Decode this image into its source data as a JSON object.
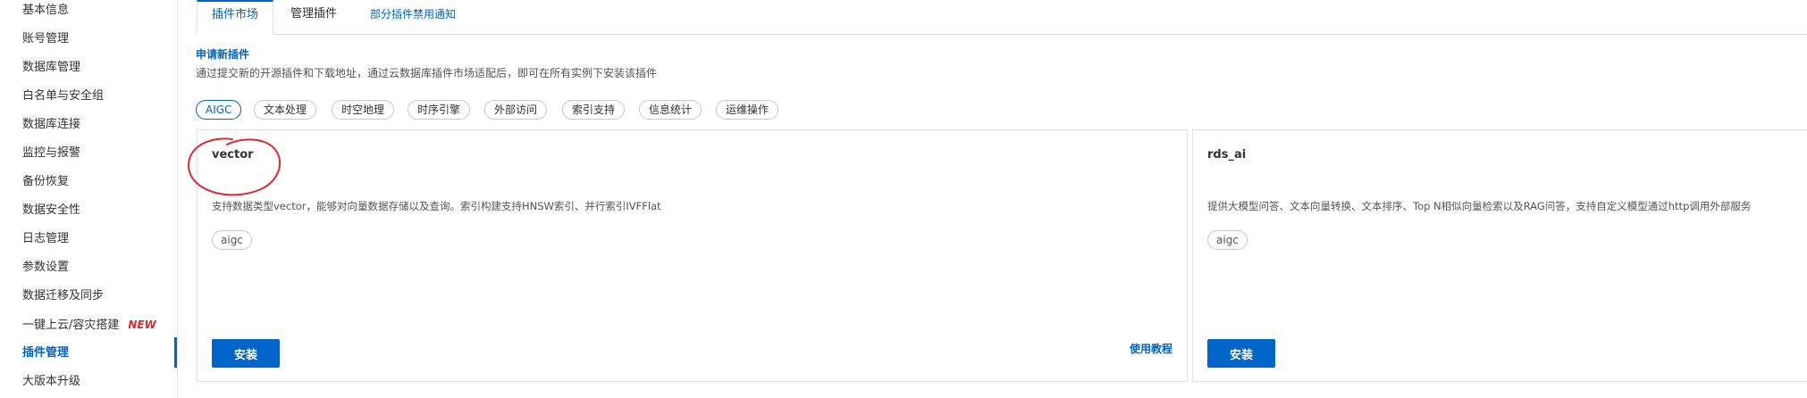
{
  "sidebar": {
    "items": [
      {
        "label": "基本信息"
      },
      {
        "label": "账号管理"
      },
      {
        "label": "数据库管理"
      },
      {
        "label": "白名单与安全组"
      },
      {
        "label": "数据库连接"
      },
      {
        "label": "监控与报警"
      },
      {
        "label": "备份恢复"
      },
      {
        "label": "数据安全性"
      },
      {
        "label": "日志管理"
      },
      {
        "label": "参数设置"
      },
      {
        "label": "数据迁移及同步"
      },
      {
        "label": "一键上云/容灾搭建",
        "badge": "NEW"
      },
      {
        "label": "插件管理",
        "active": true
      },
      {
        "label": "大版本升级"
      }
    ]
  },
  "tabs": [
    {
      "label": "插件市场",
      "active": true
    },
    {
      "label": "管理插件"
    },
    {
      "label": "部分插件禁用通知"
    }
  ],
  "apply": {
    "title": "申请新插件",
    "description": "通过提交新的开源插件和下载地址，通过云数据库插件市场适配后，即可在所有实例下安装该插件"
  },
  "filters": [
    {
      "label": "AIGC",
      "active": true
    },
    {
      "label": "文本处理"
    },
    {
      "label": "时空地理"
    },
    {
      "label": "时序引擎"
    },
    {
      "label": "外部访问"
    },
    {
      "label": "索引支持"
    },
    {
      "label": "信息统计"
    },
    {
      "label": "运维操作"
    }
  ],
  "cards": [
    {
      "title": "vector",
      "description": "支持数据类型vector，能够对向量数据存储以及查询。索引构建支持HNSW索引、并行索引IVFFlat",
      "tag": "aigc",
      "install_label": "安装",
      "tutorial_label": "使用教程"
    },
    {
      "title": "rds_ai",
      "description": "提供大模型问答、文本向量转换、文本排序、Top N相似向量检索以及RAG问答，支持自定义模型通过http调用外部服务",
      "tag": "aigc",
      "install_label": "安装"
    }
  ],
  "colors": {
    "accent": "#0064c8",
    "annotation": "#e0282e",
    "new_badge": "#e0282e"
  }
}
